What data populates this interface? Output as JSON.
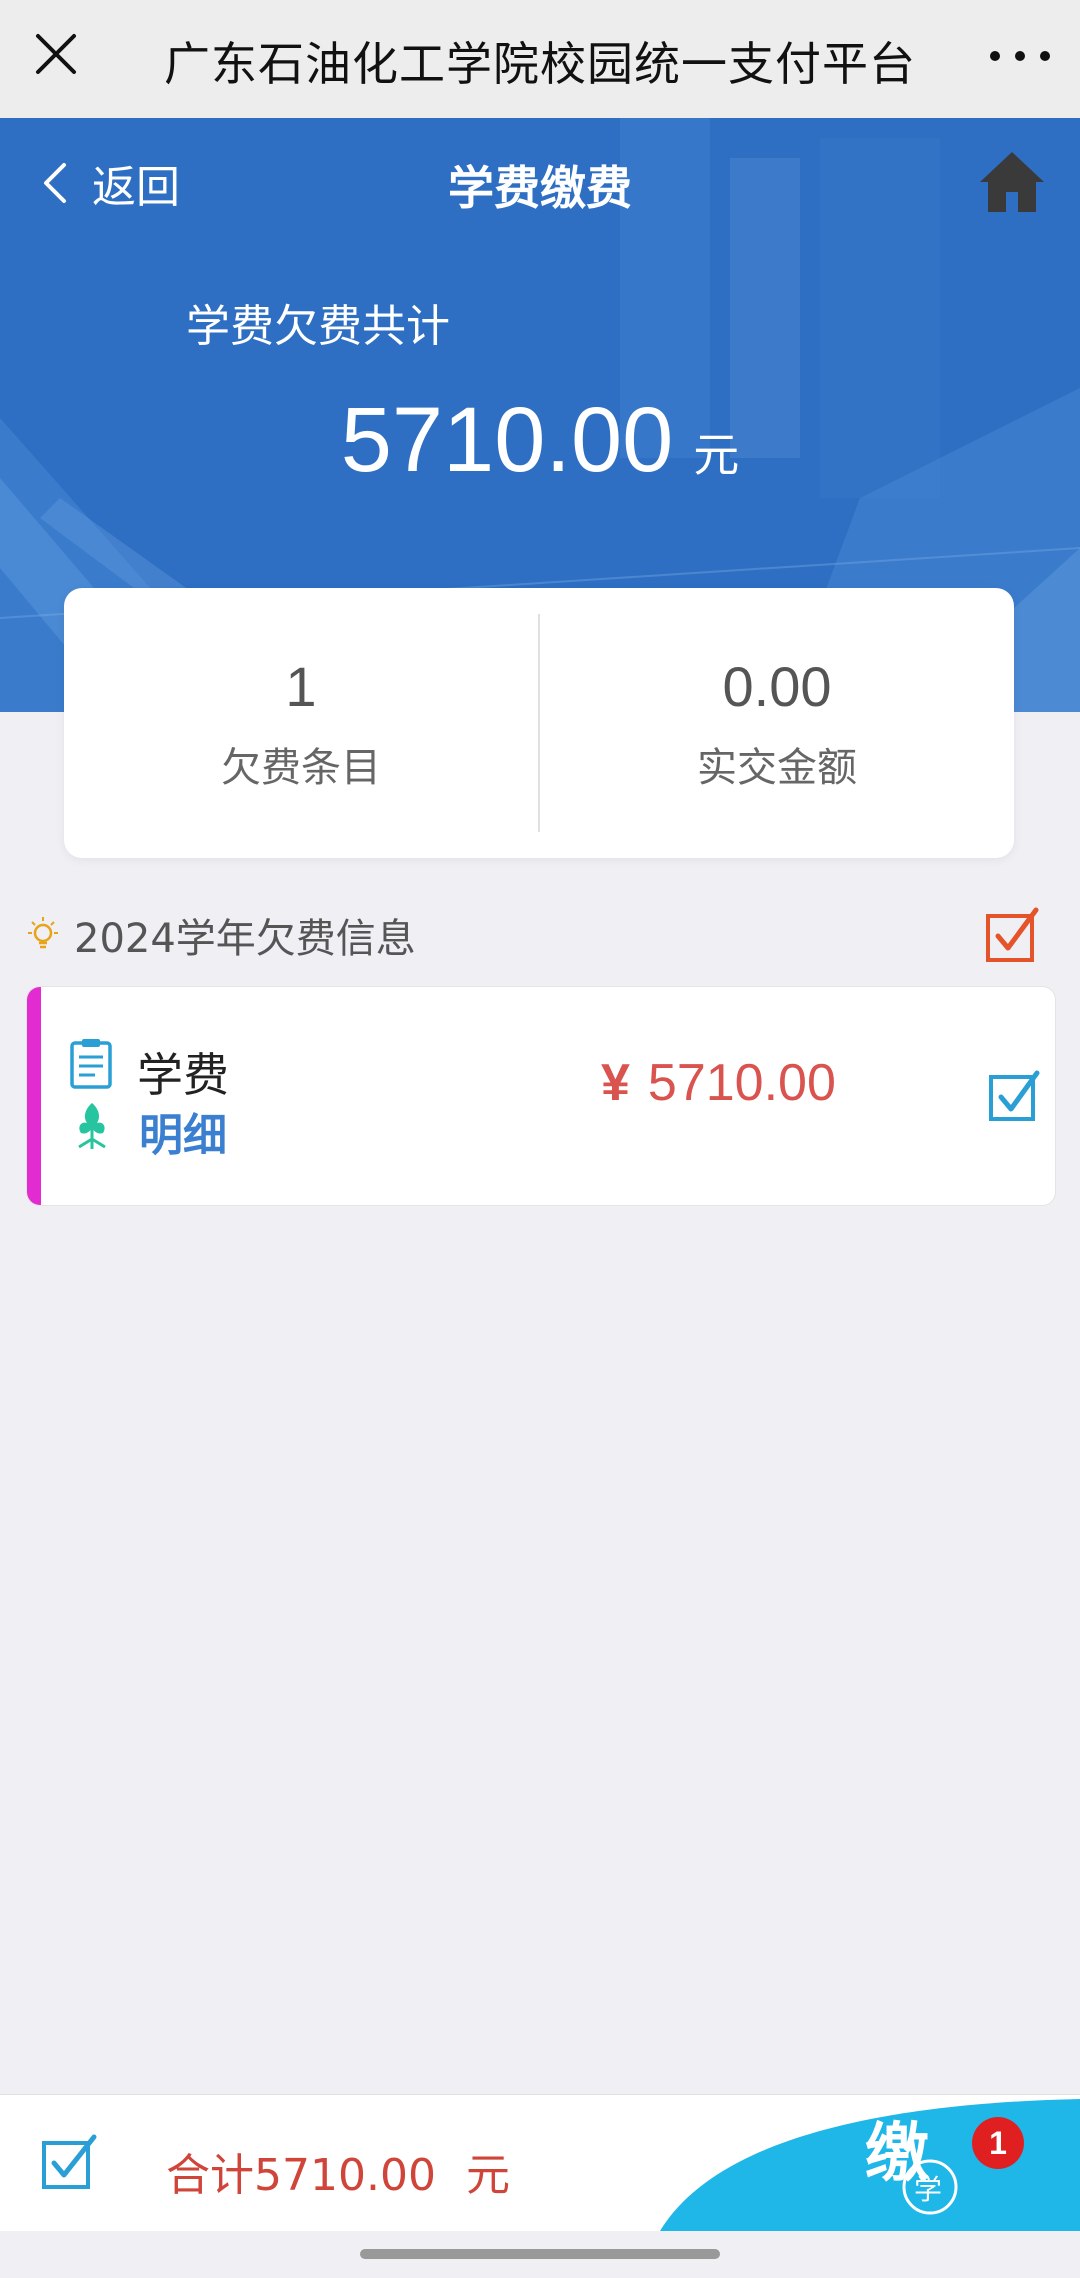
{
  "topbar": {
    "title": "广东石油化工学院校园统一支付平台",
    "close_icon": "close-icon",
    "more_icon": "more-icon"
  },
  "header": {
    "back_label": "返回",
    "page_title": "学费缴费",
    "home_icon": "home-icon",
    "owe_label": "学费欠费共计",
    "owe_amount": "5710.00",
    "owe_unit": "元"
  },
  "summary": {
    "items": [
      {
        "value": "1",
        "label": "欠费条目"
      },
      {
        "value": "0.00",
        "label": "实交金额"
      }
    ]
  },
  "section": {
    "title": "2024学年欠费信息",
    "icon": "bulb-icon"
  },
  "fee_item": {
    "name": "学费",
    "detail_label": "明细",
    "currency": "¥",
    "amount": "5710.00",
    "checked": true
  },
  "footer": {
    "total_text": "合计5710.00",
    "total_unit": "元",
    "badge_count": "1",
    "pay_icon": "pay-tuition-icon"
  },
  "colors": {
    "header_blue": "#2f73c8",
    "price_red": "#d9534f",
    "check_blue": "#2a9fd6",
    "check_orange": "#e5532b",
    "accent_magenta": "#e22bd1",
    "pay_cyan": "#1fb6e8"
  }
}
